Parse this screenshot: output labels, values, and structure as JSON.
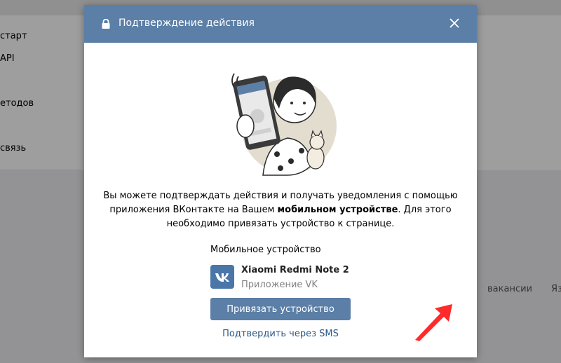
{
  "background": {
    "left_items": [
      "старт",
      "API",
      "етодов",
      "связь"
    ],
    "footer_items": [
      "вакансии",
      "Яз"
    ]
  },
  "modal": {
    "title": "Подтверждение действия",
    "description_part1": "Вы можете подтверждать действия и получать уведомления с помощью приложения ВКонтакте на Вашем ",
    "description_bold": "мобильном устройстве",
    "description_part2": ". Для этого необходимо привязать устройство к странице.",
    "device_section_label": "Мобильное устройство",
    "device_name": "Xiaomi Redmi Note 2",
    "device_app": "Приложение VK",
    "bind_button_label": "Привязать устройство",
    "sms_link": "Подтвердить через SMS"
  },
  "colors": {
    "header": "#5b7fa6",
    "button": "#5b7fa6",
    "link": "#2a5885",
    "arrow": "#ff2a2a"
  },
  "icons": [
    "lock-icon",
    "close-icon",
    "vk-logo",
    "red-arrow"
  ]
}
